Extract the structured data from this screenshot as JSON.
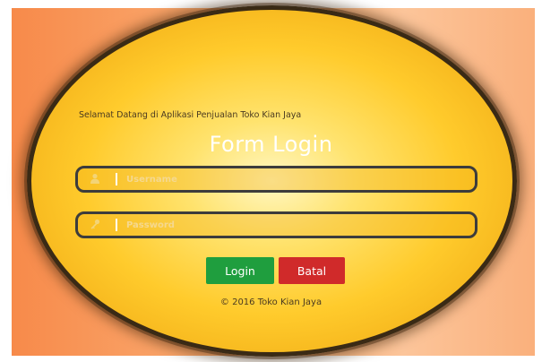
{
  "login": {
    "welcome_text": "Selamat Datang di Aplikasi Penjualan Toko Kian Jaya",
    "title": "Form Login",
    "username": {
      "value": "",
      "placeholder": "Username",
      "icon": "user-icon"
    },
    "password": {
      "value": "",
      "placeholder": "Password",
      "icon": "key-icon"
    },
    "login_button_label": "Login",
    "cancel_button_label": "Batal",
    "footer_text": "© 2016 Toko Kian Jaya"
  },
  "colors": {
    "login_button": "#1f9e3e",
    "cancel_button": "#d02a2a",
    "oval_fill": "#ffcb2c",
    "oval_border": "#3a2a15",
    "background": "#fbb077"
  }
}
